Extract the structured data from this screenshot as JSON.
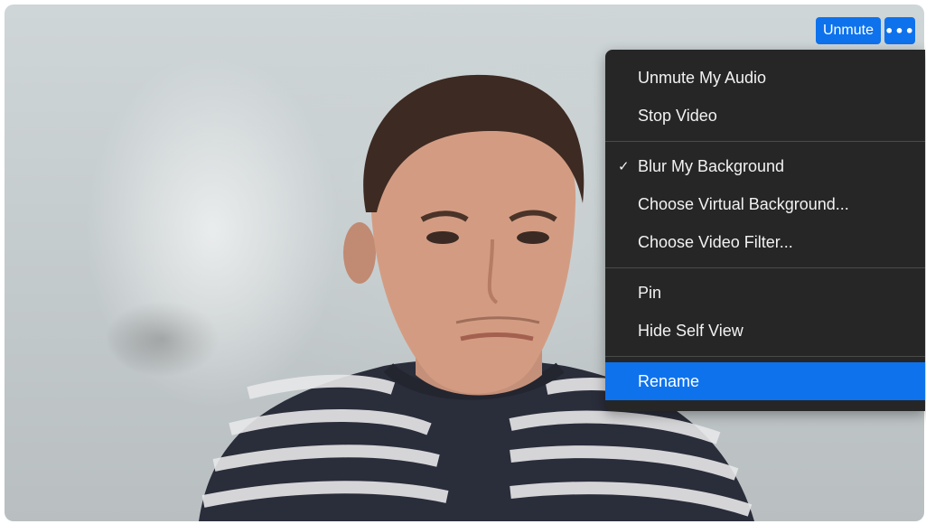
{
  "controls": {
    "unmute_label": "Unmute",
    "more_label": "•••"
  },
  "menu": {
    "groups": [
      [
        {
          "label": "Unmute My Audio",
          "checked": false
        },
        {
          "label": "Stop Video",
          "checked": false
        }
      ],
      [
        {
          "label": "Blur My Background",
          "checked": true
        },
        {
          "label": "Choose Virtual Background...",
          "checked": false
        },
        {
          "label": "Choose Video Filter...",
          "checked": false
        }
      ],
      [
        {
          "label": "Pin",
          "checked": false
        },
        {
          "label": "Hide Self View",
          "checked": false
        }
      ],
      [
        {
          "label": "Rename",
          "checked": false,
          "highlighted": true
        }
      ]
    ],
    "check_glyph": "✓"
  },
  "colors": {
    "accent": "#0e72ed",
    "menu_bg": "#262626",
    "menu_text": "#f2f2f2"
  },
  "icons": {
    "more": "more-options-icon",
    "check": "checkmark-icon"
  }
}
